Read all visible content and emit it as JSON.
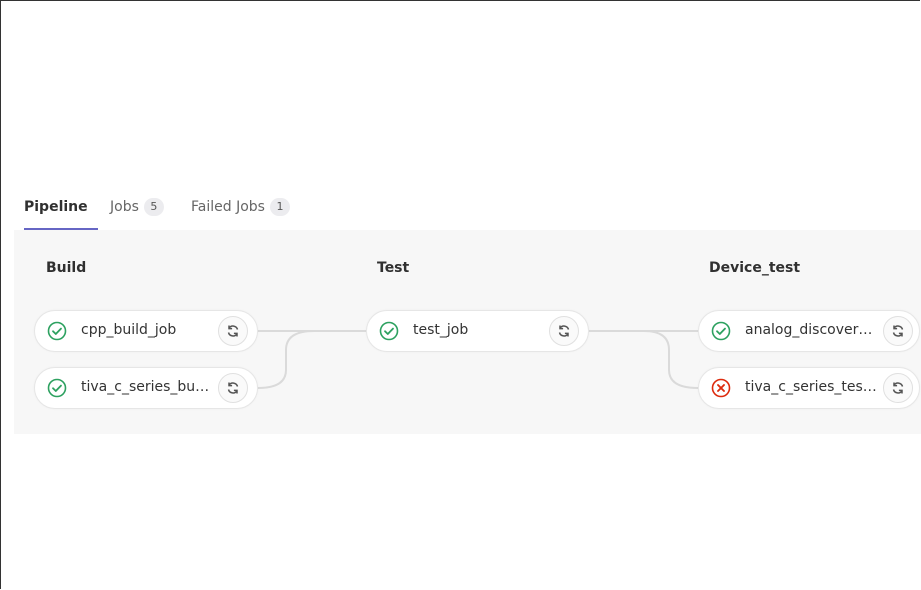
{
  "tabs": [
    {
      "label": "Pipeline"
    },
    {
      "label": "Jobs",
      "count": "5"
    },
    {
      "label": "Failed Jobs",
      "count": "1"
    }
  ],
  "stages": [
    {
      "title": "Build",
      "jobs": [
        {
          "name": "cpp_build_job",
          "status": "success"
        },
        {
          "name": "tiva_c_series_buil...",
          "status": "success"
        }
      ]
    },
    {
      "title": "Test",
      "jobs": [
        {
          "name": "test_job",
          "status": "success"
        }
      ]
    },
    {
      "title": "Device_test",
      "jobs": [
        {
          "name": "analog_discovery...",
          "status": "success"
        },
        {
          "name": "tiva_c_series_test...",
          "status": "failed"
        }
      ]
    }
  ],
  "icons": {
    "success": "check-circle-icon",
    "failed": "x-circle-icon",
    "retry": "retry-icon"
  },
  "colors": {
    "success": "#2da160",
    "failed": "#dd2b0e",
    "active_tab": "#6666c4"
  }
}
